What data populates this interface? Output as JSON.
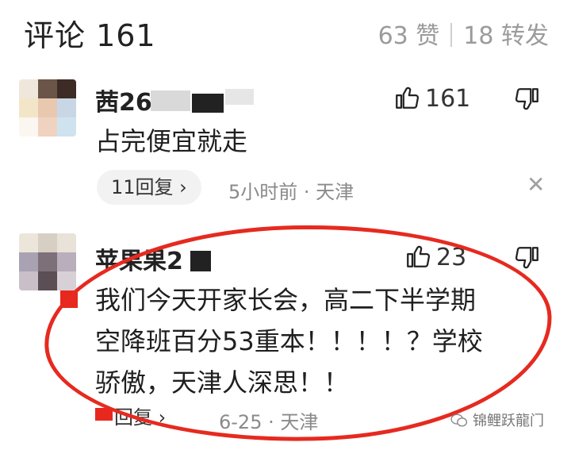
{
  "header": {
    "title": "评论 161",
    "likes": "63 赞",
    "reposts": "18 转发"
  },
  "comments": [
    {
      "username": "茜26",
      "like_count": "161",
      "text": "占完便宜就走",
      "reply_label": "11回复 ›",
      "meta": "5小时前 · 天津"
    },
    {
      "username": "苹果果2",
      "like_count": "23",
      "text_lines": [
        "我们今天开家长会，高二下半学期",
        "空降班百分53重本！！！！？学校",
        "骄傲，天津人深思！！"
      ],
      "reply_label": "回复 ›",
      "meta": "6-25 · 天津"
    }
  ],
  "watermark": "锦鲤跃龍门",
  "colors": {
    "annotation_red": "#e62a1f",
    "muted_text": "#8a8a8a",
    "pill_bg": "#f2f2f2"
  },
  "icons": {
    "like": "thumbs-up-icon",
    "dislike": "thumbs-down-icon",
    "close": "close-icon",
    "watermark": "wechat-icon"
  }
}
